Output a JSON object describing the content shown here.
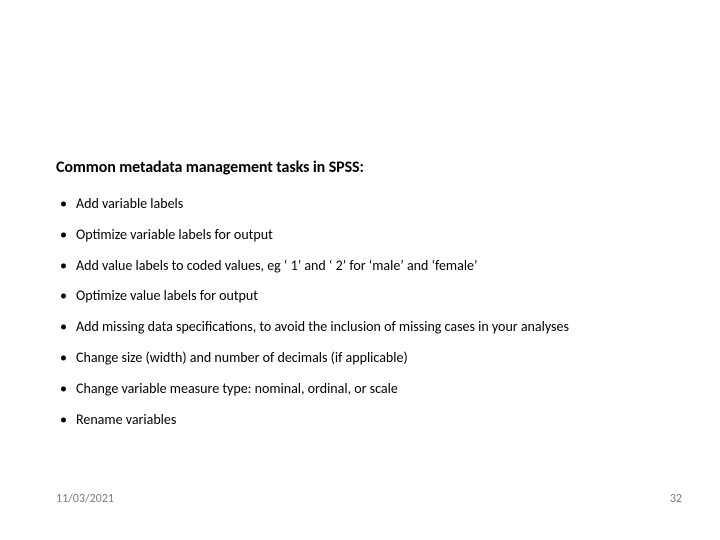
{
  "slide": {
    "heading": "Common metadata management tasks in SPSS:",
    "bullets": [
      "Add variable labels",
      "Optimize variable labels for output",
      "Add value labels to coded values, eg ‘ 1’ and ‘ 2’ for ‘male’ and ‘female’",
      "Optimize value labels for output",
      "Add missing data specifications, to avoid the inclusion of missing cases in your analyses",
      "Change size (width) and number of decimals (if applicable)",
      "Change variable measure type: nominal, ordinal, or scale",
      "Rename variables"
    ],
    "footer": {
      "date": "11/03/2021",
      "page": "32"
    }
  }
}
